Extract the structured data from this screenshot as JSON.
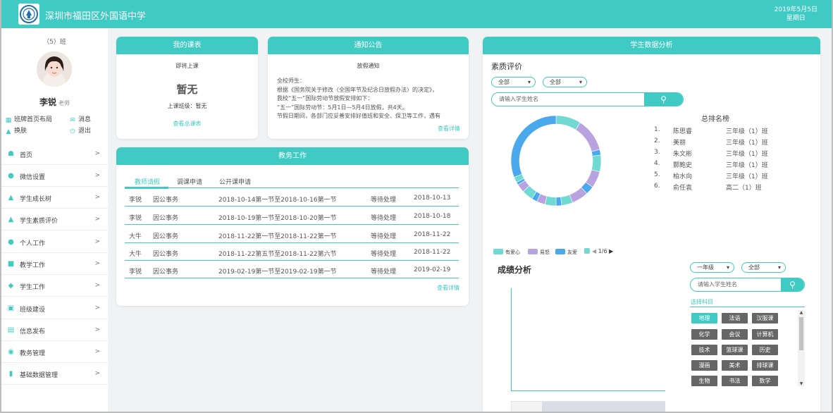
{
  "header": {
    "title": "深圳市福田区外国语中学",
    "date": "2019年5月5日",
    "weekday": "星期日"
  },
  "user": {
    "class": "（5）班",
    "name": "李锐",
    "role": "老师"
  },
  "user_links": [
    {
      "label": "班牌首页布局",
      "icon": "layout-icon"
    },
    {
      "label": "消息",
      "icon": "message-icon"
    },
    {
      "label": "换肤",
      "icon": "shirt-icon"
    },
    {
      "label": "退出",
      "icon": "power-icon"
    }
  ],
  "nav": [
    {
      "label": "首页",
      "icon": "home-icon",
      "arrow": ">"
    },
    {
      "label": "微信设置",
      "icon": "wechat-icon",
      "arrow": ">"
    },
    {
      "label": "学生成长树",
      "icon": "tree-icon",
      "arrow": ">"
    },
    {
      "label": "学生素质评价",
      "icon": "thumbs-up-icon",
      "arrow": ">"
    },
    {
      "label": "个人工作",
      "icon": "person-icon",
      "arrow": ">"
    },
    {
      "label": "教学工作",
      "icon": "folder-icon",
      "arrow": ">"
    },
    {
      "label": "学生工作",
      "icon": "graduation-cap-icon",
      "arrow": ">"
    },
    {
      "label": "班级建设",
      "icon": "monitor-icon",
      "arrow": ">"
    },
    {
      "label": "信息发布",
      "icon": "newspaper-icon",
      "arrow": ">"
    },
    {
      "label": "教务管理",
      "icon": "target-icon",
      "arrow": ">"
    },
    {
      "label": "基础数据管理",
      "icon": "books-icon",
      "arrow": ">"
    }
  ],
  "schedule": {
    "title": "我的课表",
    "subtitle": "即将上课",
    "current": "暂无",
    "class_line": "上课班级：暂无",
    "link": "查看总课表"
  },
  "notice": {
    "title": "通知公告",
    "heading": "放假通知",
    "lines": [
      "全校师生：",
      "根据《国务院关于修改〈全国年节及纪念日放假办法〉的决定》，",
      "我校“五一”国际劳动节放假安排如下：",
      "“五一”国际劳动节：5月1日—5月4日放假，共4天。",
      "节假日期间，各部门应妥善安排好值班和安全、保卫等工作，遇有"
    ],
    "link": "查看详情"
  },
  "affairs": {
    "title": "教务工作",
    "tabs": [
      "教师请假",
      "调课申请",
      "公开课申请"
    ],
    "rows": [
      {
        "name": "李锐",
        "type": "因公事务",
        "period": "2018-10-14第一节至2018-10-16第一节",
        "status": "等待处理",
        "date": "2018-10-13"
      },
      {
        "name": "李锐",
        "type": "因公事务",
        "period": "2018-10-19第一节至2018-10-20第一节",
        "status": "等待处理",
        "date": "2018-10-18"
      },
      {
        "name": "大牛",
        "type": "因公事务",
        "period": "2018-11-22第一节至2018-11-22第一节",
        "status": "等待处理",
        "date": "2018-11-22"
      },
      {
        "name": "大牛",
        "type": "因公事务",
        "period": "2018-11-22第五节至2018-11-22第六节",
        "status": "等待处理",
        "date": "2018-11-22"
      },
      {
        "name": "李锐",
        "type": "因公事务",
        "period": "2019-02-19第一节至2019-02-19第一节",
        "status": "等待处理",
        "date": "2019-02-19"
      }
    ],
    "link": "查看详情"
  },
  "analysis": {
    "title": "学生数据分析",
    "quality": {
      "title": "素质评价",
      "filter1": "全部",
      "filter2": "全部",
      "search_placeholder": "请输入学生姓名",
      "ranking_title": "总排名榜",
      "ranking": [
        {
          "rank": "1.",
          "name": "陈思睿",
          "class": "三年级（1）班"
        },
        {
          "rank": "2.",
          "name": "美丽",
          "class": "三年级（1）班"
        },
        {
          "rank": "3.",
          "name": "朱文彬",
          "class": "三年级（1）班"
        },
        {
          "rank": "4.",
          "name": "酆鲍史",
          "class": "三年级（1）班"
        },
        {
          "rank": "5.",
          "name": "柏水向",
          "class": "三年级（1）班"
        },
        {
          "rank": "6.",
          "name": "俞任袁",
          "class": "高二（1）班"
        }
      ],
      "legend": [
        {
          "name": "有爱心",
          "color": "#6fd9d2"
        },
        {
          "name": "易怒",
          "color": "#b8a3e0"
        },
        {
          "name": "友爱",
          "color": "#4aa8ec"
        }
      ],
      "legend_page": "1/6"
    },
    "grades": {
      "title": "成绩分析",
      "filter1": "一年级",
      "filter2": "全部",
      "search_placeholder": "请输入学生姓名",
      "subject_label": "选择科目",
      "subjects": [
        "地理",
        "法语",
        "汉服课",
        "化学",
        "会议",
        "计算机",
        "技术",
        "篮球课",
        "历史",
        "漫画",
        "美术",
        "排球课",
        "生物",
        "书法",
        "数学"
      ],
      "active_subject": "地理"
    }
  },
  "chart_data": {
    "type": "pie",
    "donut": true,
    "categories_shown_in_legend": [
      "有爱心",
      "易怒",
      "友爱"
    ],
    "slices": [
      {
        "color": "#6fd9d2",
        "value": 9
      },
      {
        "color": "#b8a3e0",
        "value": 12
      },
      {
        "color": "#4aa8ec",
        "value": 2
      },
      {
        "color": "#6fd9d2",
        "value": 6
      },
      {
        "color": "#b8a3e0",
        "value": 6
      },
      {
        "color": "#4aa8ec",
        "value": 3
      },
      {
        "color": "#b8a3e0",
        "value": 6
      },
      {
        "color": "#6fd9d2",
        "value": 4
      },
      {
        "color": "#4aa8ec",
        "value": 2
      },
      {
        "color": "#6fd9d2",
        "value": 4
      },
      {
        "color": "#b8a3e0",
        "value": 3
      },
      {
        "color": "#4aa8ec",
        "value": 2
      },
      {
        "color": "#6fd9d2",
        "value": 4
      },
      {
        "color": "#b8a3e0",
        "value": 3
      },
      {
        "color": "#4aa8ec",
        "value": 1
      },
      {
        "color": "#6fd9d2",
        "value": 2
      },
      {
        "color": "#4aa8ec",
        "value": 31
      }
    ]
  },
  "colors": {
    "accent": "#3fcbc4",
    "subject_inactive": "#666666",
    "background": "#f1f2f4"
  }
}
